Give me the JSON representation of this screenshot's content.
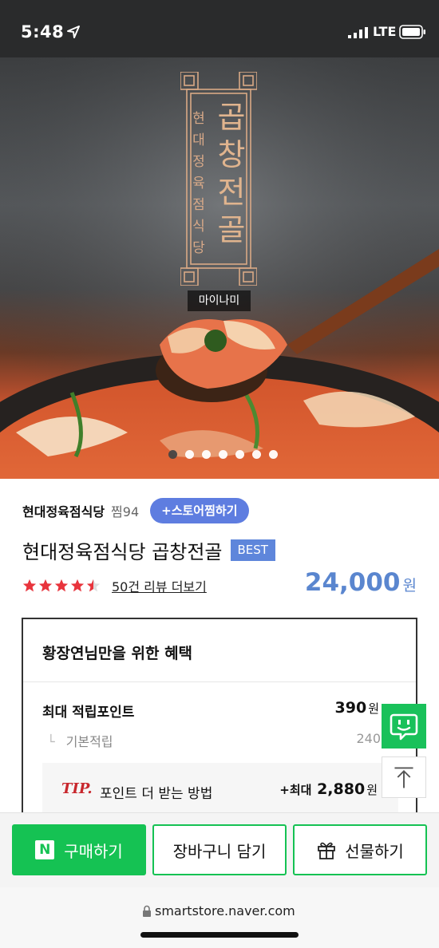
{
  "status_bar": {
    "time": "5:48",
    "network": "LTE"
  },
  "hero": {
    "logo_main": "곱창전골",
    "logo_sub": "현대정육점식당",
    "brand_tag": "마이나미",
    "carousel": {
      "total": 7,
      "active_index": 0
    }
  },
  "product": {
    "store_name": "현대정육점식당",
    "like_count": "찜94",
    "store_fav_label": "+스토어찜하기",
    "title": "현대정육점식당 곱창전골",
    "badge": "BEST",
    "rating_stars": 4.5,
    "review_link": "50건 리뷰 더보기",
    "price": "24,000",
    "price_unit": "원",
    "price_color": "#5a86cf"
  },
  "benefit": {
    "title": "황장연님만을 위한 혜택",
    "max_point_label": "최대 적립포인트",
    "max_point_value": "390",
    "max_point_unit": "원",
    "base_label": "기본적립",
    "base_value": "240",
    "tip_label": "TIP.",
    "tip_text": "포인트 더 받는 방법",
    "tip_prefix": "+최대",
    "tip_value": "2,880",
    "tip_unit": "원"
  },
  "floating": {
    "talk_icon": "talk-icon",
    "top_icon": "arrow-up-icon"
  },
  "actions": {
    "buy_logo": "N",
    "buy_label": "구매하기",
    "cart_label": "장바구니 담기",
    "gift_label": "선물하기",
    "accent_color": "#15c253"
  },
  "browser": {
    "url": "smartstore.naver.com"
  }
}
